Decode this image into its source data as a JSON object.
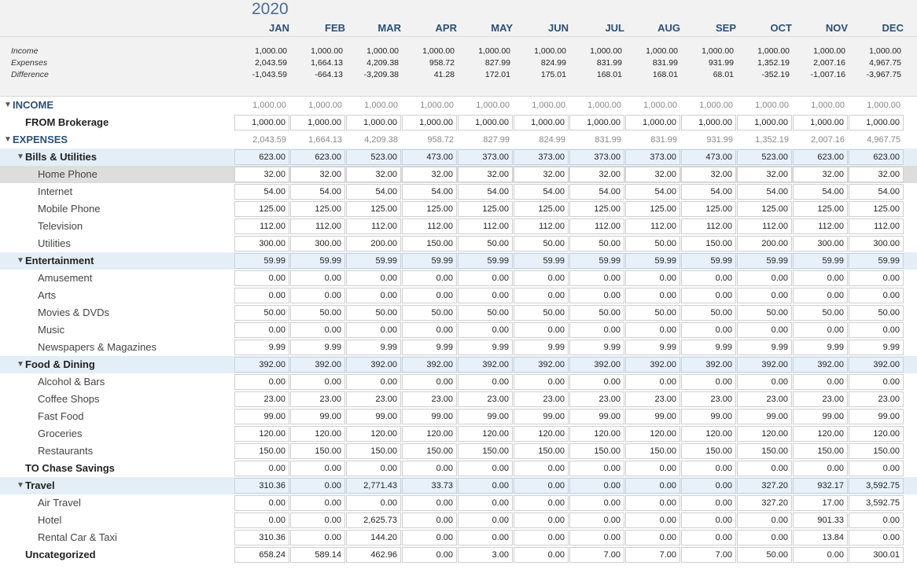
{
  "year": "2020",
  "months": [
    "JAN",
    "FEB",
    "MAR",
    "APR",
    "MAY",
    "JUN",
    "JUL",
    "AUG",
    "SEP",
    "OCT",
    "NOV",
    "DEC"
  ],
  "summary": [
    {
      "label": "Income",
      "values": [
        "1,000.00",
        "1,000.00",
        "1,000.00",
        "1,000.00",
        "1,000.00",
        "1,000.00",
        "1,000.00",
        "1,000.00",
        "1,000.00",
        "1,000.00",
        "1,000.00",
        "1,000.00"
      ]
    },
    {
      "label": "Expenses",
      "values": [
        "2,043.59",
        "1,664.13",
        "4,209.38",
        "958.72",
        "827.99",
        "824.99",
        "831.99",
        "831.99",
        "931.99",
        "1,352.19",
        "2,007.16",
        "4,967.75"
      ]
    },
    {
      "label": "Difference",
      "values": [
        "-1,043.59",
        "-664.13",
        "-3,209.38",
        "41.28",
        "172.01",
        "175.01",
        "168.01",
        "168.01",
        "68.01",
        "-352.19",
        "-1,007.16",
        "-3,967.75"
      ]
    }
  ],
  "rows": [
    {
      "label": "INCOME",
      "level": "top",
      "collapsible": true,
      "cells": "plain",
      "values": [
        "1,000.00",
        "1,000.00",
        "1,000.00",
        "1,000.00",
        "1,000.00",
        "1,000.00",
        "1,000.00",
        "1,000.00",
        "1,000.00",
        "1,000.00",
        "1,000.00",
        "1,000.00"
      ]
    },
    {
      "label": "FROM Brokerage",
      "level": "cat",
      "values": [
        "1,000.00",
        "1,000.00",
        "1,000.00",
        "1,000.00",
        "1,000.00",
        "1,000.00",
        "1,000.00",
        "1,000.00",
        "1,000.00",
        "1,000.00",
        "1,000.00",
        "1,000.00"
      ]
    },
    {
      "label": "EXPENSES",
      "level": "top",
      "collapsible": true,
      "cells": "plain",
      "values": [
        "2,043.59",
        "1,664.13",
        "4,209.38",
        "958.72",
        "827.99",
        "824.99",
        "831.99",
        "831.99",
        "931.99",
        "1,352.19",
        "2,007.16",
        "4,967.75"
      ]
    },
    {
      "label": "Bills & Utilities",
      "level": "cat",
      "collapsible": true,
      "group": true,
      "values": [
        "623.00",
        "623.00",
        "523.00",
        "473.00",
        "373.00",
        "373.00",
        "373.00",
        "373.00",
        "473.00",
        "523.00",
        "623.00",
        "623.00"
      ]
    },
    {
      "label": "Home Phone",
      "level": "sub",
      "selected": true,
      "values": [
        "32.00",
        "32.00",
        "32.00",
        "32.00",
        "32.00",
        "32.00",
        "32.00",
        "32.00",
        "32.00",
        "32.00",
        "32.00",
        "32.00"
      ]
    },
    {
      "label": "Internet",
      "level": "sub",
      "values": [
        "54.00",
        "54.00",
        "54.00",
        "54.00",
        "54.00",
        "54.00",
        "54.00",
        "54.00",
        "54.00",
        "54.00",
        "54.00",
        "54.00"
      ]
    },
    {
      "label": "Mobile Phone",
      "level": "sub",
      "values": [
        "125.00",
        "125.00",
        "125.00",
        "125.00",
        "125.00",
        "125.00",
        "125.00",
        "125.00",
        "125.00",
        "125.00",
        "125.00",
        "125.00"
      ]
    },
    {
      "label": "Television",
      "level": "sub",
      "values": [
        "112.00",
        "112.00",
        "112.00",
        "112.00",
        "112.00",
        "112.00",
        "112.00",
        "112.00",
        "112.00",
        "112.00",
        "112.00",
        "112.00"
      ]
    },
    {
      "label": "Utilities",
      "level": "sub",
      "values": [
        "300.00",
        "300.00",
        "200.00",
        "150.00",
        "50.00",
        "50.00",
        "50.00",
        "50.00",
        "150.00",
        "200.00",
        "300.00",
        "300.00"
      ]
    },
    {
      "label": "Entertainment",
      "level": "cat",
      "collapsible": true,
      "group": true,
      "values": [
        "59.99",
        "59.99",
        "59.99",
        "59.99",
        "59.99",
        "59.99",
        "59.99",
        "59.99",
        "59.99",
        "59.99",
        "59.99",
        "59.99"
      ]
    },
    {
      "label": "Amusement",
      "level": "sub",
      "values": [
        "0.00",
        "0.00",
        "0.00",
        "0.00",
        "0.00",
        "0.00",
        "0.00",
        "0.00",
        "0.00",
        "0.00",
        "0.00",
        "0.00"
      ]
    },
    {
      "label": "Arts",
      "level": "sub",
      "values": [
        "0.00",
        "0.00",
        "0.00",
        "0.00",
        "0.00",
        "0.00",
        "0.00",
        "0.00",
        "0.00",
        "0.00",
        "0.00",
        "0.00"
      ]
    },
    {
      "label": "Movies & DVDs",
      "level": "sub",
      "values": [
        "50.00",
        "50.00",
        "50.00",
        "50.00",
        "50.00",
        "50.00",
        "50.00",
        "50.00",
        "50.00",
        "50.00",
        "50.00",
        "50.00"
      ]
    },
    {
      "label": "Music",
      "level": "sub",
      "values": [
        "0.00",
        "0.00",
        "0.00",
        "0.00",
        "0.00",
        "0.00",
        "0.00",
        "0.00",
        "0.00",
        "0.00",
        "0.00",
        "0.00"
      ]
    },
    {
      "label": "Newspapers & Magazines",
      "level": "sub",
      "values": [
        "9.99",
        "9.99",
        "9.99",
        "9.99",
        "9.99",
        "9.99",
        "9.99",
        "9.99",
        "9.99",
        "9.99",
        "9.99",
        "9.99"
      ]
    },
    {
      "label": "Food & Dining",
      "level": "cat",
      "collapsible": true,
      "group": true,
      "values": [
        "392.00",
        "392.00",
        "392.00",
        "392.00",
        "392.00",
        "392.00",
        "392.00",
        "392.00",
        "392.00",
        "392.00",
        "392.00",
        "392.00"
      ]
    },
    {
      "label": "Alcohol & Bars",
      "level": "sub",
      "values": [
        "0.00",
        "0.00",
        "0.00",
        "0.00",
        "0.00",
        "0.00",
        "0.00",
        "0.00",
        "0.00",
        "0.00",
        "0.00",
        "0.00"
      ]
    },
    {
      "label": "Coffee Shops",
      "level": "sub",
      "values": [
        "23.00",
        "23.00",
        "23.00",
        "23.00",
        "23.00",
        "23.00",
        "23.00",
        "23.00",
        "23.00",
        "23.00",
        "23.00",
        "23.00"
      ]
    },
    {
      "label": "Fast Food",
      "level": "sub",
      "values": [
        "99.00",
        "99.00",
        "99.00",
        "99.00",
        "99.00",
        "99.00",
        "99.00",
        "99.00",
        "99.00",
        "99.00",
        "99.00",
        "99.00"
      ]
    },
    {
      "label": "Groceries",
      "level": "sub",
      "values": [
        "120.00",
        "120.00",
        "120.00",
        "120.00",
        "120.00",
        "120.00",
        "120.00",
        "120.00",
        "120.00",
        "120.00",
        "120.00",
        "120.00"
      ]
    },
    {
      "label": "Restaurants",
      "level": "sub",
      "values": [
        "150.00",
        "150.00",
        "150.00",
        "150.00",
        "150.00",
        "150.00",
        "150.00",
        "150.00",
        "150.00",
        "150.00",
        "150.00",
        "150.00"
      ]
    },
    {
      "label": "TO Chase Savings",
      "level": "cat",
      "values": [
        "0.00",
        "0.00",
        "0.00",
        "0.00",
        "0.00",
        "0.00",
        "0.00",
        "0.00",
        "0.00",
        "0.00",
        "0.00",
        "0.00"
      ]
    },
    {
      "label": "Travel",
      "level": "cat",
      "collapsible": true,
      "group": true,
      "values": [
        "310.36",
        "0.00",
        "2,771.43",
        "33.73",
        "0.00",
        "0.00",
        "0.00",
        "0.00",
        "0.00",
        "327.20",
        "932.17",
        "3,592.75"
      ]
    },
    {
      "label": "Air Travel",
      "level": "sub",
      "values": [
        "0.00",
        "0.00",
        "0.00",
        "0.00",
        "0.00",
        "0.00",
        "0.00",
        "0.00",
        "0.00",
        "327.20",
        "17.00",
        "3,592.75"
      ]
    },
    {
      "label": "Hotel",
      "level": "sub",
      "values": [
        "0.00",
        "0.00",
        "2,625.73",
        "0.00",
        "0.00",
        "0.00",
        "0.00",
        "0.00",
        "0.00",
        "0.00",
        "901.33",
        "0.00"
      ]
    },
    {
      "label": "Rental Car & Taxi",
      "level": "sub",
      "values": [
        "310.36",
        "0.00",
        "144.20",
        "0.00",
        "0.00",
        "0.00",
        "0.00",
        "0.00",
        "0.00",
        "0.00",
        "13.84",
        "0.00"
      ]
    },
    {
      "label": "Uncategorized",
      "level": "cat",
      "values": [
        "658.24",
        "589.14",
        "462.96",
        "0.00",
        "3.00",
        "0.00",
        "7.00",
        "7.00",
        "7.00",
        "50.00",
        "0.00",
        "300.01"
      ]
    }
  ]
}
